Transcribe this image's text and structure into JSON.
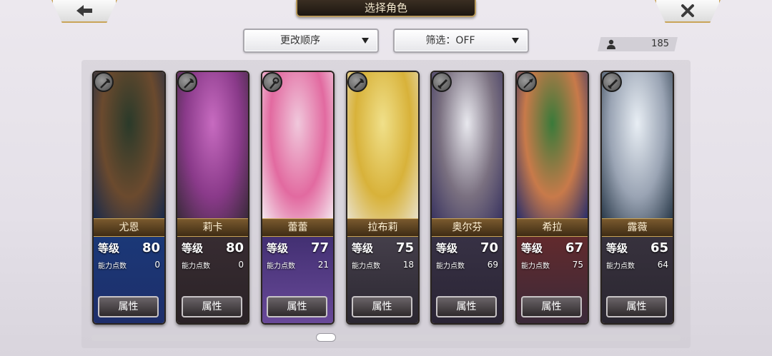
{
  "header": {
    "title": "选择角色"
  },
  "toolbar": {
    "sort_label": "更改顺序",
    "filter_label": "筛选：OFF",
    "owned_count": "185"
  },
  "cards_common": {
    "level_label": "等级",
    "points_label": "能力点数",
    "attr_button": "属性"
  },
  "characters": [
    {
      "name": "尤恩",
      "level": "80",
      "points": "0",
      "class_icon": "axe-icon",
      "portrait": [
        "#2a3a2a",
        "#6b4a2e",
        "#1a2a4a"
      ],
      "lower": [
        "#1a3a7a",
        "#1e2e6a"
      ]
    },
    {
      "name": "莉卡",
      "level": "80",
      "points": "0",
      "class_icon": "axe-icon",
      "portrait": [
        "#c76bc0",
        "#8a3a8a",
        "#3a2a3a"
      ],
      "lower": [
        "#3a2e34",
        "#2a2226"
      ]
    },
    {
      "name": "蕾蕾",
      "level": "77",
      "points": "21",
      "class_icon": "staff-icon",
      "portrait": [
        "#f0c8dc",
        "#e26aa0",
        "#f4e6ee"
      ],
      "lower": [
        "#3a2a6a",
        "#6a4a9a"
      ]
    },
    {
      "name": "拉布莉",
      "level": "75",
      "points": "18",
      "class_icon": "axe-icon",
      "portrait": [
        "#f0e08a",
        "#d8b23a",
        "#e8e0c8"
      ],
      "lower": [
        "#4a4450",
        "#2a2630"
      ]
    },
    {
      "name": "奥尔芬",
      "level": "70",
      "points": "69",
      "class_icon": "sword-icon",
      "portrait": [
        "#e8e8ee",
        "#7a7080",
        "#3a3460"
      ],
      "lower": [
        "#3a3448",
        "#2a2434"
      ]
    },
    {
      "name": "希拉",
      "level": "67",
      "points": "75",
      "class_icon": "spear-icon",
      "portrait": [
        "#3a7a3a",
        "#c87a4a",
        "#2a2e6a"
      ],
      "lower": [
        "#6a2a2a",
        "#3a2a3a"
      ]
    },
    {
      "name": "露薇",
      "level": "65",
      "points": "64",
      "class_icon": "sword-icon",
      "portrait": [
        "#e8eef4",
        "#9aa4b4",
        "#2a3a4a"
      ],
      "lower": [
        "#3a3440",
        "#2a2630"
      ]
    }
  ]
}
